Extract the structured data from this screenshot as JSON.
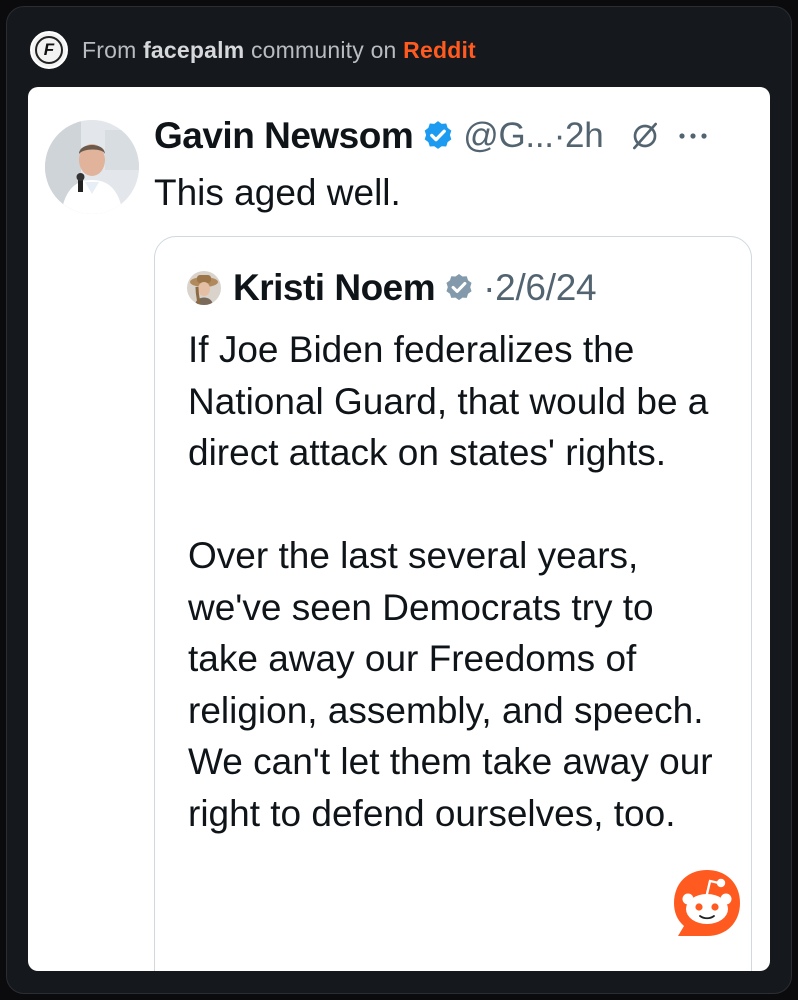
{
  "header": {
    "prefix": "From",
    "community": "facepalm",
    "middle": "community on",
    "platform": "Reddit"
  },
  "tweet": {
    "author_name": "Gavin Newsom",
    "handle": "@G...",
    "time": "·2h",
    "text": "This aged well."
  },
  "quoted_tweet": {
    "author_name": "Kristi Noem",
    "date": "·2/6/24",
    "paragraphs": [
      "If Joe Biden federalizes the National Guard, that would be a direct attack on states' rights.",
      "Over the last several years, we've seen Democrats try to take away our Freedoms of religion, assembly, and speech. We can't let them take away our right to defend ourselves, too."
    ]
  },
  "icons": {
    "logo": "facepalm-logo-icon",
    "verified": "verified-badge-icon",
    "grok": "grok-icon",
    "more": "more-options-icon",
    "snoo": "reddit-snoo-icon"
  },
  "colors": {
    "page_background": "#15181c",
    "reddit_accent": "#ff5a1f",
    "verified_blue": "#1d9bf0",
    "verified_gray": "#829aab",
    "text_primary": "#0f1419",
    "text_secondary": "#536471"
  }
}
